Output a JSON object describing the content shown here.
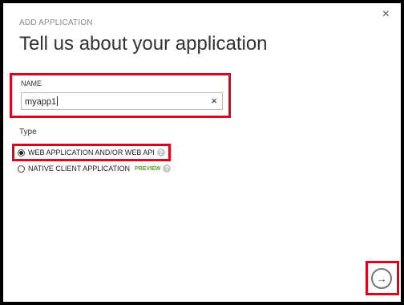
{
  "dialog": {
    "subtitle": "ADD APPLICATION",
    "title": "Tell us about your application",
    "close_icon": "×"
  },
  "name_field": {
    "label": "NAME",
    "value": "myapp1",
    "clear_icon": "×"
  },
  "type": {
    "label": "Type",
    "options": [
      {
        "label": "WEB APPLICATION AND/OR WEB API",
        "selected": true,
        "help": "?"
      },
      {
        "label": "NATIVE CLIENT APPLICATION",
        "selected": false,
        "badge": "PREVIEW",
        "help": "?"
      }
    ]
  },
  "next_button": {
    "icon": "→"
  },
  "colors": {
    "highlight": "#e3001b",
    "preview": "#5aa22f"
  }
}
